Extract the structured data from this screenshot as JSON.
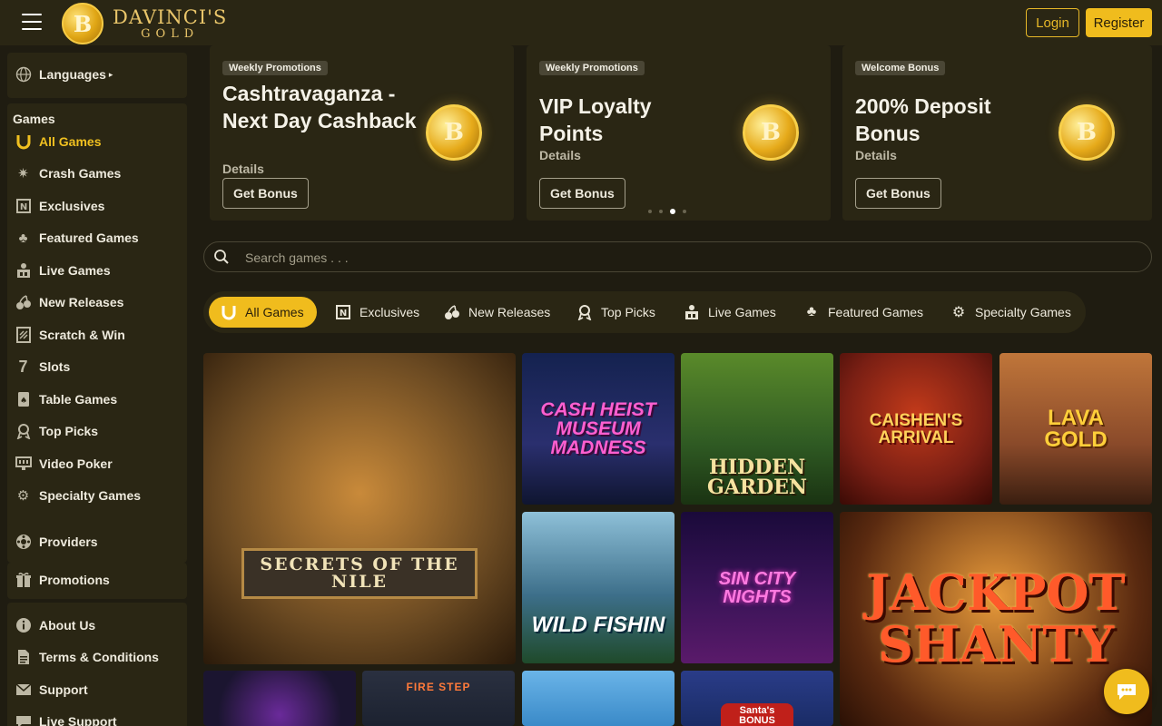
{
  "header": {
    "logo_line1": "DAVINCI'S",
    "logo_line2": "GOLD",
    "logo_coin": "B",
    "login_label": "Login",
    "register_label": "Register"
  },
  "sidebar": {
    "languages_label": "Languages",
    "games_heading": "Games",
    "games": [
      {
        "label": "All Games",
        "icon": "horseshoe-icon",
        "active": true
      },
      {
        "label": "Crash Games",
        "icon": "crash-star-icon"
      },
      {
        "label": "Exclusives",
        "icon": "exclusive-badge-icon"
      },
      {
        "label": "Featured Games",
        "icon": "clover-icon"
      },
      {
        "label": "Live Games",
        "icon": "live-dealer-icon"
      },
      {
        "label": "New Releases",
        "icon": "new-cherries-icon"
      },
      {
        "label": "Scratch & Win",
        "icon": "scratch-card-icon"
      },
      {
        "label": "Slots",
        "icon": "seven-icon"
      },
      {
        "label": "Table Games",
        "icon": "table-cards-icon"
      },
      {
        "label": "Top Picks",
        "icon": "award-ribbon-icon"
      },
      {
        "label": "Video Poker",
        "icon": "video-poker-icon"
      },
      {
        "label": "Specialty Games",
        "icon": "specialty-gear-icon"
      }
    ],
    "providers_label": "Providers",
    "promotions_label": "Promotions",
    "info": [
      {
        "label": "About Us",
        "icon": "info-icon"
      },
      {
        "label": "Terms & Conditions",
        "icon": "document-icon"
      },
      {
        "label": "Support",
        "icon": "mail-icon"
      },
      {
        "label": "Live Support",
        "icon": "chat-icon"
      }
    ]
  },
  "promos": [
    {
      "tag": "Weekly Promotions",
      "title": "Cashtravaganza - Next Day Cashback",
      "details": "Details",
      "button": "Get Bonus"
    },
    {
      "tag": "Weekly Promotions",
      "title": "VIP Loyalty Points",
      "details": "Details",
      "button": "Get Bonus"
    },
    {
      "tag": "Welcome Bonus",
      "title": "200% Deposit Bonus",
      "details": "Details",
      "button": "Get Bonus"
    }
  ],
  "carousel": {
    "count": 4,
    "active_index": 2
  },
  "search": {
    "placeholder": "Search games . . ."
  },
  "tabs": [
    {
      "label": "All Games",
      "icon": "horseshoe-icon",
      "active": true
    },
    {
      "label": "Exclusives",
      "icon": "exclusive-badge-icon"
    },
    {
      "label": "New Releases",
      "icon": "new-cherries-icon"
    },
    {
      "label": "Top Picks",
      "icon": "award-ribbon-icon"
    },
    {
      "label": "Live Games",
      "icon": "live-dealer-icon"
    },
    {
      "label": "Featured Games",
      "icon": "clover-icon"
    },
    {
      "label": "Specialty Games",
      "icon": "specialty-gear-icon"
    }
  ],
  "games": [
    {
      "title": "SECRETS OF THE NILE",
      "color": "#6b4a22"
    },
    {
      "title": "CASH HEIST MUSEUM MADNESS",
      "color": "#1d2a5e"
    },
    {
      "title": "HIDDEN GARDEN",
      "color": "#2f5a23"
    },
    {
      "title": "CAISHEN'S ARRIVAL",
      "color": "#7a1f14"
    },
    {
      "title": "LAVA GOLD",
      "color": "#8a4a2a"
    },
    {
      "title": "WILD FISHIN",
      "color": "#3d6f8a"
    },
    {
      "title": "SIN CITY NIGHTS",
      "color": "#3a1458"
    },
    {
      "title": "JACKPOT SHANTY",
      "color": "#5a2a10"
    },
    {
      "title": "",
      "color": "#1b1530"
    },
    {
      "title": "FIRE STEP",
      "color": "#1c2230"
    },
    {
      "title": "",
      "color": "#3a8ac8"
    },
    {
      "title": "Santa's BONUS",
      "color": "#1a2c66"
    }
  ],
  "colors": {
    "accent": "#f0bc1d",
    "panel": "#2a2614",
    "background": "#1f1c11"
  }
}
